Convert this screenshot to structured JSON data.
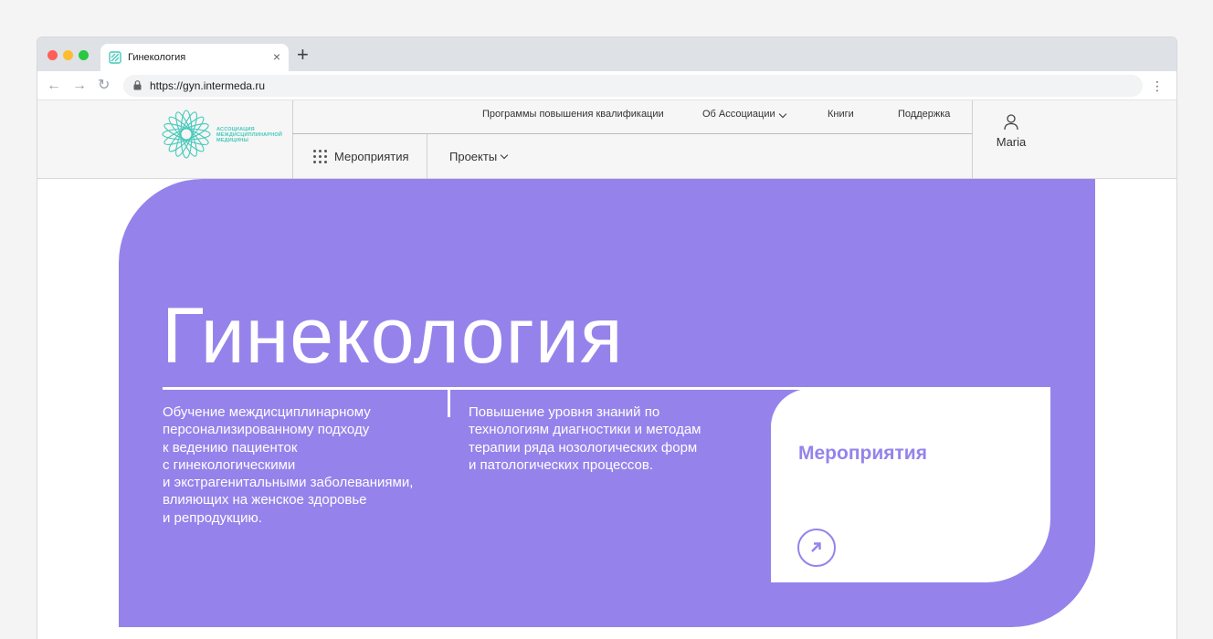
{
  "browser": {
    "tab_title": "Гинекология",
    "tab_close": "×",
    "new_tab": "+",
    "url": "https://gyn.intermeda.ru",
    "nav_back": "←",
    "nav_forward": "→",
    "nav_reload": "↻",
    "menu": "⋮"
  },
  "header": {
    "logo_lines": [
      "АССОЦИАЦИЯ",
      "МЕЖДИСЦИПЛИНАРНОЙ",
      "МЕДИЦИНЫ"
    ],
    "top_links": [
      "Программы повышения квалификации",
      "Об Ассоциации",
      "Книги",
      "Поддержка"
    ],
    "events_label": "Мероприятия",
    "projects_label": "Проекты",
    "user_name": "Maria"
  },
  "hero": {
    "title": "Гинекология",
    "left_lines": [
      "Обучение междисциплинарному",
      "персонализированному подходу",
      "к ведению пациенток",
      "с гинекологическими",
      "и экстрагенитальными заболеваниями,",
      "влияющих на женское здоровье",
      "и репродукцию."
    ],
    "right_lines": [
      "Повышение уровня знаний по",
      "технологиям диагностики и методам",
      "терапии ряда нозологических форм",
      "и патологических процессов."
    ],
    "card_title": "Мероприятия"
  },
  "colors": {
    "accent": "#9583eb",
    "logo": "#45c9ba"
  }
}
